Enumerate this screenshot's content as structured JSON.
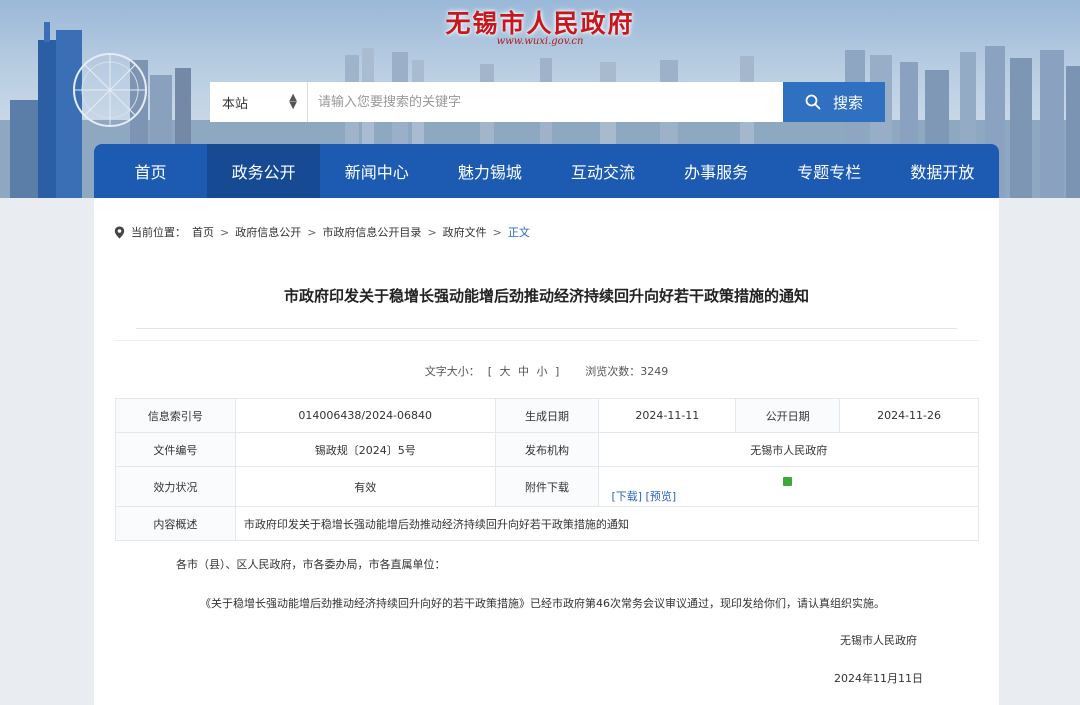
{
  "header": {
    "site_title": "无锡市人民政府",
    "site_url": "www.wuxi.gov.cn"
  },
  "search": {
    "scope": "本站",
    "placeholder": "请输入您要搜索的关键字",
    "button_label": "搜索"
  },
  "nav": {
    "items": [
      "首页",
      "政务公开",
      "新闻中心",
      "魅力锡城",
      "互动交流",
      "办事服务",
      "专题专栏",
      "数据开放"
    ],
    "active": "政务公开"
  },
  "breadcrumb": {
    "prefix": "当前位置：",
    "items": [
      "首页",
      "政府信息公开",
      "市政府信息公开目录",
      "政府文件",
      "正文"
    ],
    "sep": ">"
  },
  "document": {
    "title": "市政府印发关于稳增长强动能增后劲推动经济持续回升向好若干政策措施的通知",
    "font_size_label": "文字大小：",
    "font_size_options": "[ 大 中 小 ]",
    "views_label": "浏览次数：",
    "views": "3249"
  },
  "info": {
    "index_no_label": "信息索引号",
    "index_no": "014006438/2024-06840",
    "created_label": "生成日期",
    "created": "2024-11-11",
    "published_label": "公开日期",
    "published": "2024-11-26",
    "doc_no_label": "文件编号",
    "doc_no": "锡政规〔2024〕5号",
    "issuer_label": "发布机构",
    "issuer": "无锡市人民政府",
    "status_label": "效力状况",
    "status": "有效",
    "attachment_label": "附件下载",
    "download_link": "[下载]",
    "preview_link": "[预览]",
    "summary_label": "内容概述",
    "summary": "市政府印发关于稳增长强动能增后劲推动经济持续回升向好若干政策措施的通知"
  },
  "body": {
    "salutation": "各市（县）、区人民政府，市各委办局，市各直属单位：",
    "paragraph": "《关于稳增长强动能增后劲推动经济持续回升向好的若干政策措施》已经市政府第46次常务会议审议通过，现印发给你们，请认真组织实施。",
    "signature": "无锡市人民政府",
    "date": "2024年11月11日"
  },
  "colors": {
    "nav_bg": "#1d5bb2",
    "nav_active": "#164b94",
    "search_button": "#2f70c1",
    "title_red": "#c8161d",
    "link_blue": "#2a67c0"
  }
}
